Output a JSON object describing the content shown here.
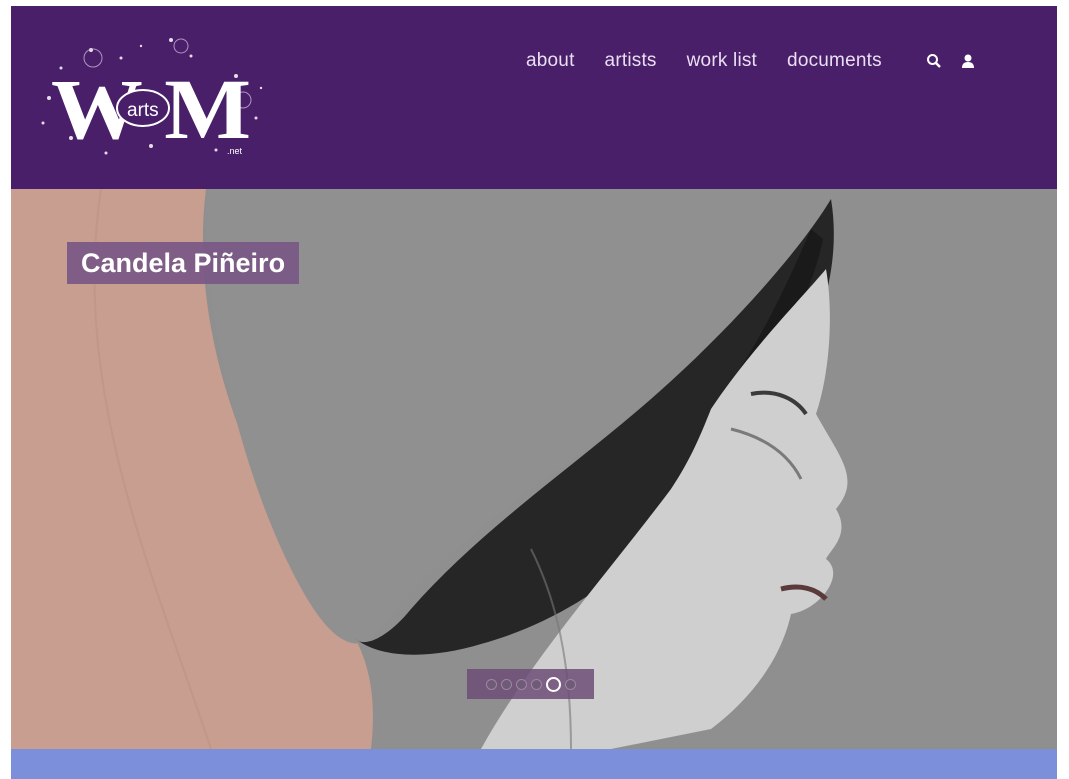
{
  "logo": {
    "big_letters": "W M",
    "word": "arts",
    "suffix": ".net"
  },
  "nav": {
    "items": [
      {
        "label": "about"
      },
      {
        "label": "artists"
      },
      {
        "label": "work list"
      },
      {
        "label": "documents"
      }
    ],
    "icons": [
      "search-icon",
      "user-icon"
    ]
  },
  "hero": {
    "caption": "Candela Piñeiro",
    "slides": {
      "total": 6,
      "active_index": 4
    }
  },
  "colors": {
    "header_bg": "#4a1f69",
    "caption_bg": "#7a5886",
    "band": "#7b8fdb"
  }
}
